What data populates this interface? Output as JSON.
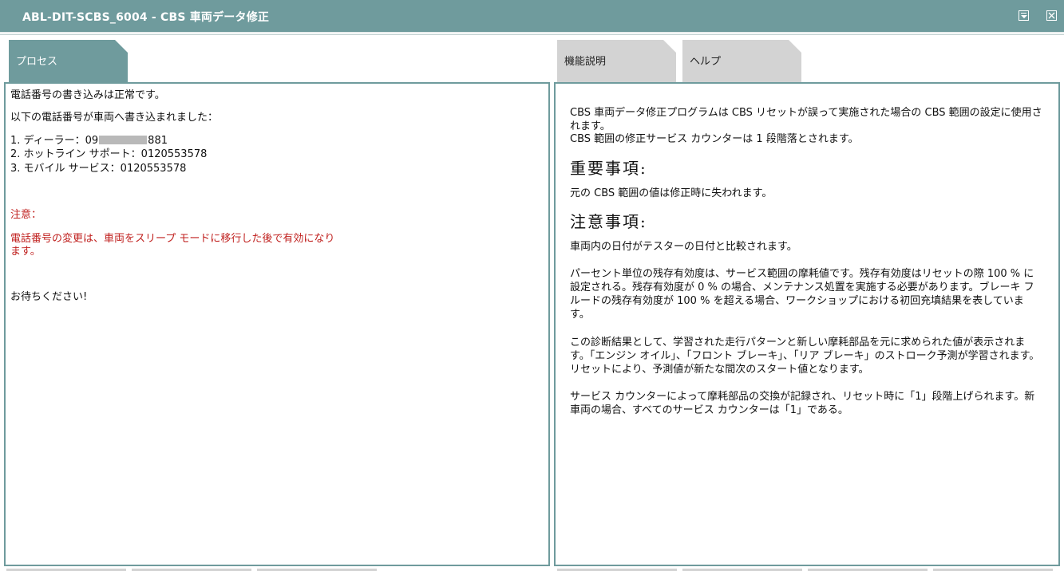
{
  "window": {
    "title": "ABL-DIT-SCBS_6004  -  CBS 車両データ修正",
    "minimize_icon": "minimize-icon",
    "close_icon": "close-icon"
  },
  "tabs": {
    "process": "プロセス",
    "function": "機能説明",
    "help": "ヘルプ"
  },
  "process_panel": {
    "line1": "電話番号の書き込みは正常です。",
    "line2": "以下の電話番号が車両へ書き込まれました：",
    "phones": [
      {
        "prefix": "1. ディーラー：09",
        "suffix": "881"
      },
      {
        "text": "2. ホットライン サポート：0120553578"
      },
      {
        "text": "3. モバイル サービス：0120553578"
      }
    ],
    "note_title": "注意：",
    "note_line1": "電話番号の変更は、車両をスリープ モードに移行した後で有効になり",
    "note_line2": "ます。",
    "wait": "お待ちください!"
  },
  "description_panel": {
    "intro": "CBS 車両データ修正プログラムは CBS リセットが誤って実施された場合の CBS 範囲の設定に使用されます。",
    "intro2": "CBS 範囲の修正サービス カウンターは 1 段階落とされます。",
    "important_heading": "重要事項:",
    "important_text": "元の CBS 範囲の値は修正時に失われます。",
    "caution_heading": "注意事項:",
    "caution_text1": "車両内の日付がテスターの日付と比較されます。",
    "caution_text2": "パーセント単位の残存有効度は、サービス範囲の摩耗値です。残存有効度はリセットの際 100 % に設定される。残存有効度が 0 % の場合、メンテナンス処置を実施する必要があります。ブレーキ フルードの残存有効度が 100 % を超える場合、ワークショップにおける初回充填結果を表しています。",
    "caution_text3": "この診断結果として、学習された走行パターンと新しい摩耗部品を元に求められた値が表示されます。「エンジン オイル」、「フロント ブレーキ」、「リア ブレーキ」のストローク予測が学習されます。リセットにより、予測値が新たな間次のスタート値となります。",
    "caution_text4": "サービス カウンターによって摩耗部品の交換が記録され、リセット時に「1」段階上げられます。新車両の場合、すべてのサービス カウンターは「1」である。"
  },
  "colors": {
    "accent": "#6f9b9d",
    "inactive_tab": "#d3d3d3",
    "warning": "#c0211f"
  }
}
